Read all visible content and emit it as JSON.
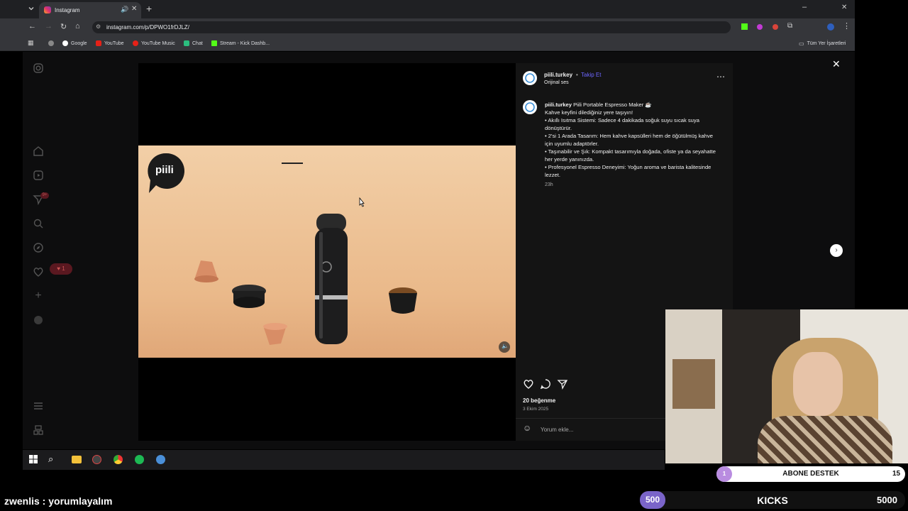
{
  "browser": {
    "tab_title": "Instagram",
    "url": "instagram.com/p/DPWO1frDJLZ/",
    "bookmarks": [
      "Google",
      "YouTube",
      "YouTube Music",
      "Chat",
      "Stream - Kick Dashb..."
    ],
    "all_bookmarks": "Tüm Yer İşaretleri"
  },
  "post": {
    "brand_logo_text": "piili",
    "author": "piili.turkey",
    "separator": "•",
    "follow": "Takip Et",
    "audio": "Orijinal ses",
    "caption_author": "piili.turkey",
    "caption_title": "Piili Portable Espresso Maker ☕",
    "caption_lines": [
      "Kahve keyfini dilediğiniz yere taşıyın!",
      "• Akıllı Isıtma Sistemi: Sadece 4 dakikada soğuk suyu sıcak suya dönüştürür.",
      "• 2'si 1 Arada Tasarım: Hem kahve kapsülleri hem de öğütülmüş kahve için uyumlu adaptörler.",
      "• Taşınabilir ve Şık: Kompakt tasarımıyla doğada, ofiste ya da seyahatte her yerde yanınızda.",
      "• Profesyonel Espresso Deneyimi: Yoğun aroma ve barista kalitesinde lezzet."
    ],
    "age": "23h",
    "likes": "20 beğenme",
    "date": "3 Ekim 2025",
    "comment_placeholder": "Yorum ekle..."
  },
  "sidebar": {
    "notif_count": "9+",
    "heart_badge": "1"
  },
  "stream": {
    "chat_user": "zwenlis",
    "chat_msg": " : yorumlayalım",
    "sub_left": "1",
    "sub_label": "ABONE DESTEK",
    "sub_right": "15",
    "kicks_left": "500",
    "kicks_label": "KICKS",
    "kicks_right": "5000"
  },
  "colors": {
    "accent": "#6d66ff",
    "kick_green": "#53fc18",
    "purple": "#7a64c9"
  }
}
